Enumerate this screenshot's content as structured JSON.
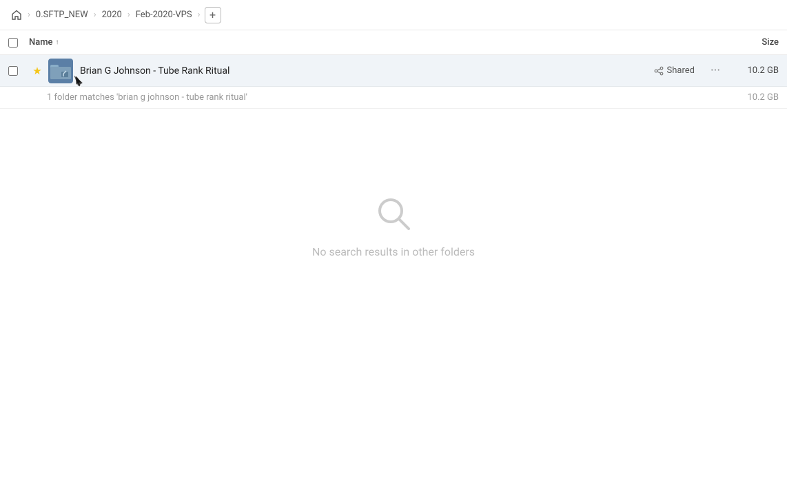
{
  "breadcrumb": {
    "home_icon": "🏠",
    "items": [
      {
        "label": "0.SFTP_NEW"
      },
      {
        "label": "2020"
      },
      {
        "label": "Feb-2020-VPS"
      }
    ],
    "add_label": "+"
  },
  "columns": {
    "name_label": "Name",
    "sort_indicator": "↑",
    "size_label": "Size"
  },
  "file_row": {
    "star": "★",
    "name": "Brian G Johnson - Tube Rank Ritual",
    "shared_label": "Shared",
    "size": "10.2 GB",
    "more_dots": "···"
  },
  "summary": {
    "text": "1 folder matches 'brian g johnson - tube rank ritual'",
    "size": "10.2 GB"
  },
  "empty_state": {
    "message": "No search results in other folders"
  },
  "checkbox_aria": "select-all"
}
